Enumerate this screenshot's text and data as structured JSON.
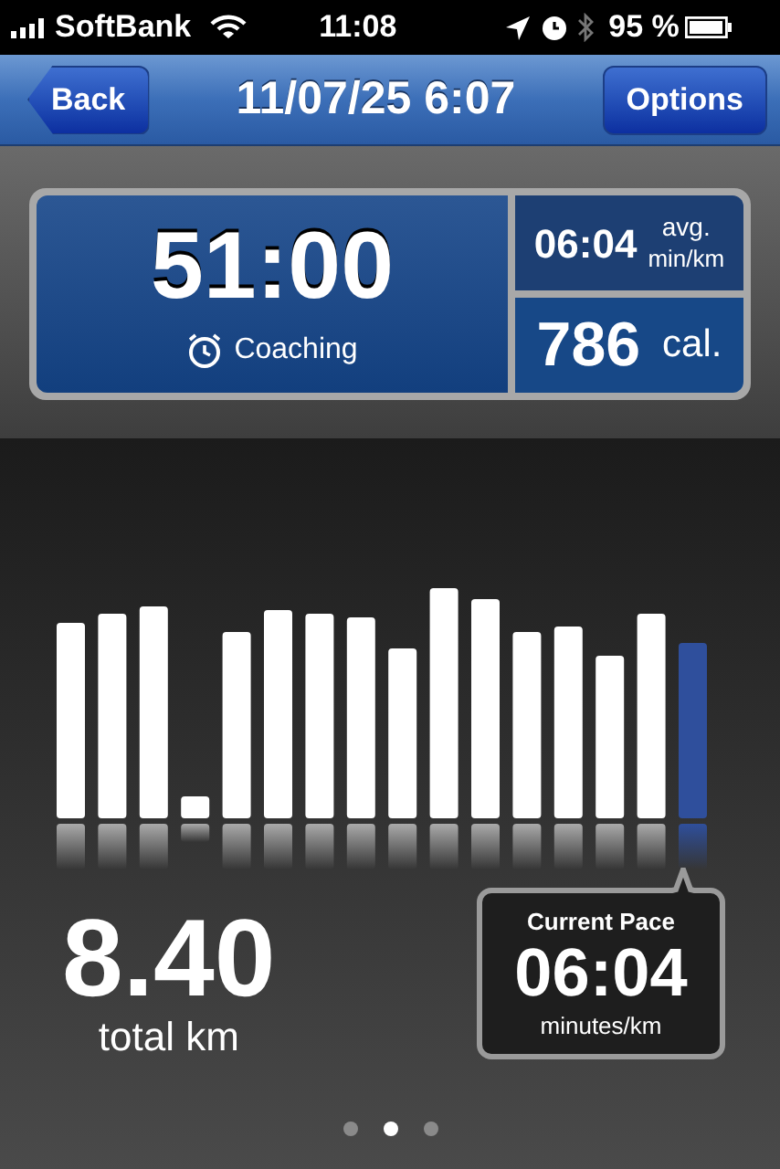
{
  "status_bar": {
    "carrier": "SoftBank",
    "time": "11:08",
    "battery": "95 %"
  },
  "nav_bar": {
    "back": "Back",
    "title": "11/07/25 6:07",
    "options": "Options"
  },
  "summary": {
    "duration": "51:00",
    "mode": "Coaching",
    "avg_pace": "06:04",
    "avg_label": "avg.",
    "avg_unit": "min/km",
    "calories": "786",
    "calories_unit": "cal."
  },
  "distance": {
    "value": "8.40",
    "unit": "total km"
  },
  "current_pace": {
    "label": "Current Pace",
    "value": "06:04",
    "unit": "minutes/km"
  },
  "page_dots": [
    {
      "selected": false
    },
    {
      "selected": true
    },
    {
      "selected": false
    }
  ]
}
